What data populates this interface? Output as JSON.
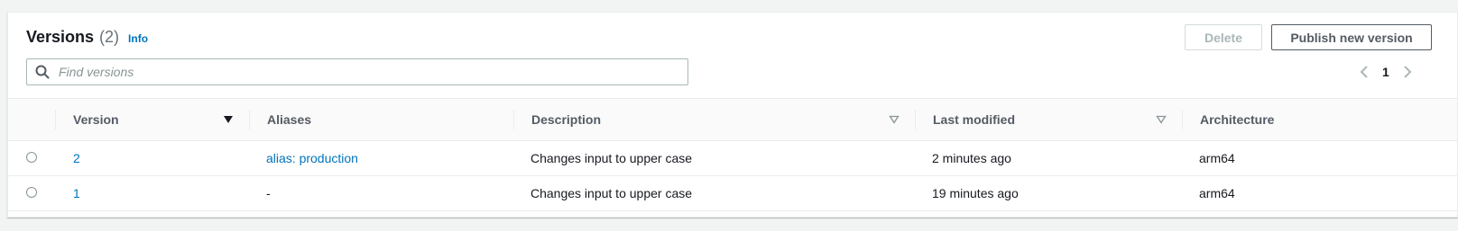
{
  "header": {
    "title": "Versions",
    "count": "(2)",
    "info_link": "Info"
  },
  "actions": {
    "delete_label": "Delete",
    "publish_label": "Publish new version"
  },
  "search": {
    "placeholder": "Find versions",
    "value": ""
  },
  "pagination": {
    "current_page": "1"
  },
  "table": {
    "columns": [
      "Version",
      "Aliases",
      "Description",
      "Last modified",
      "Architecture"
    ],
    "rows": [
      {
        "version": "2",
        "aliases": "alias: production",
        "description": "Changes input to upper case",
        "last_modified": "2 minutes ago",
        "architecture": "arm64"
      },
      {
        "version": "1",
        "aliases": "-",
        "description": "Changes input to upper case",
        "last_modified": "19 minutes ago",
        "architecture": "arm64"
      }
    ]
  },
  "colors": {
    "link": "#0073bb",
    "text": "#16191f",
    "muted": "#687078",
    "border": "#eaeded"
  }
}
